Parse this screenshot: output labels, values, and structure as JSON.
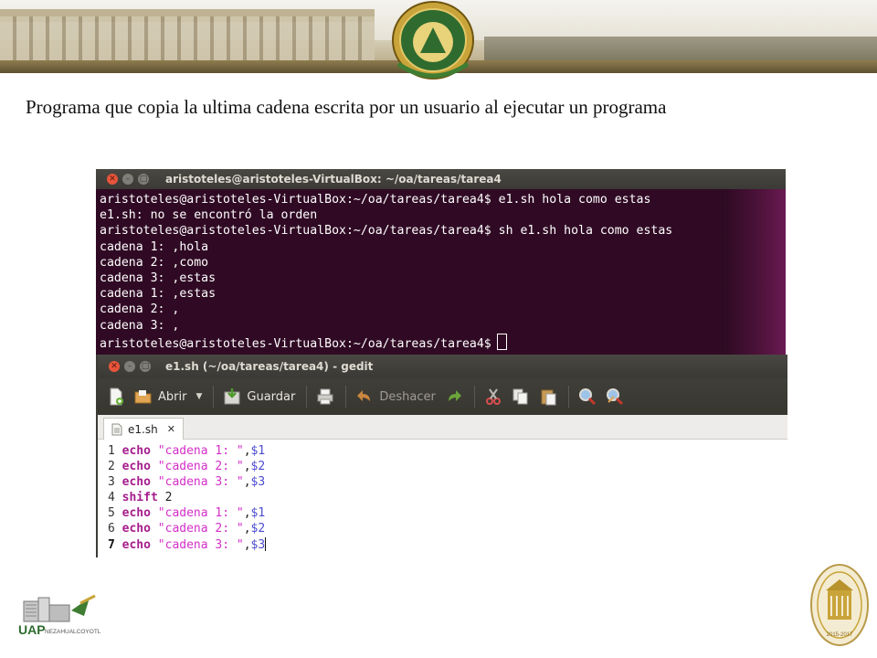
{
  "slide": {
    "caption": "Programa que copia la ultima cadena escrita por un usuario al ejecutar un programa",
    "crest_text": "ESTADOS UNIDOS MEXICANOS",
    "logo_left_text": "UAP",
    "logo_left_sub": "NEZAHUALCOYOTL",
    "seal_right_text": "UNIVERSIDAD AUTÓNOMA DEL ESTADO DE MÉXICO",
    "seal_right_years": "2015-2017"
  },
  "terminal": {
    "title": "aristoteles@aristoteles-VirtualBox: ~/oa/tareas/tarea4",
    "lines": [
      "aristoteles@aristoteles-VirtualBox:~/oa/tareas/tarea4$ e1.sh hola como estas",
      "e1.sh: no se encontró la orden",
      "aristoteles@aristoteles-VirtualBox:~/oa/tareas/tarea4$ sh e1.sh hola como estas",
      "cadena 1: ,hola",
      "cadena 2: ,como",
      "cadena 3: ,estas",
      "cadena 1: ,estas",
      "cadena 2: ,",
      "cadena 3: ,"
    ],
    "prompt": "aristoteles@aristoteles-VirtualBox:~/oa/tareas/tarea4$"
  },
  "gedit": {
    "title": "e1.sh (~/oa/tareas/tarea4) - gedit",
    "toolbar": {
      "open_label": "Abrir",
      "save_label": "Guardar",
      "undo_label": "Deshacer"
    },
    "tab_label": "e1.sh",
    "tab_close": "✕",
    "code": [
      {
        "n": "1",
        "kw": "echo",
        "str": "\"cadena 1: \"",
        "comma": ",",
        "var": "$1"
      },
      {
        "n": "2",
        "kw": "echo",
        "str": "\"cadena 2: \"",
        "comma": ",",
        "var": "$2"
      },
      {
        "n": "3",
        "kw": "echo",
        "str": "\"cadena 3: \"",
        "comma": ",",
        "var": "$3"
      },
      {
        "n": "4",
        "kw": "shift",
        "arg": "2"
      },
      {
        "n": "5",
        "kw": "echo",
        "str": "\"cadena 1: \"",
        "comma": ",",
        "var": "$1"
      },
      {
        "n": "6",
        "kw": "echo",
        "str": "\"cadena 2: \"",
        "comma": ",",
        "var": "$2"
      },
      {
        "n": "7",
        "kw": "echo",
        "str": "\"cadena 3: \"",
        "comma": ",",
        "var": "$3"
      }
    ]
  }
}
